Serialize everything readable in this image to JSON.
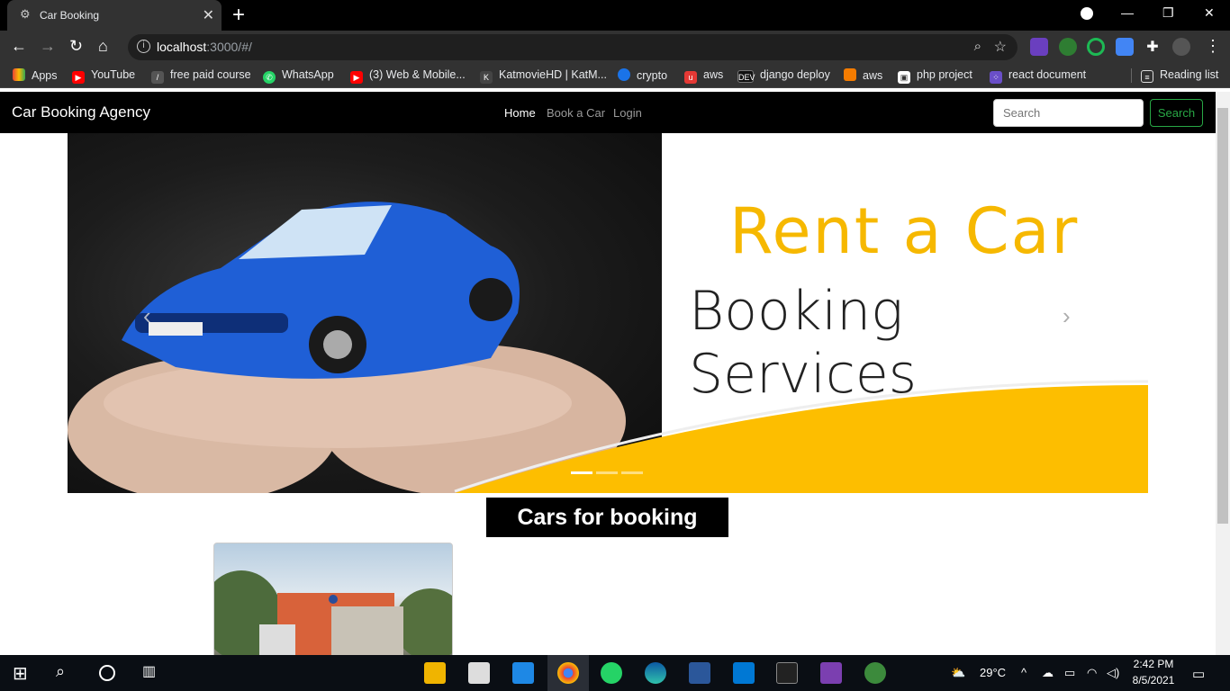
{
  "browser": {
    "tab_title": "Car Booking",
    "url_host": "localhost",
    "url_rest": ":3000/#/"
  },
  "bookmarks": [
    {
      "label": "Apps",
      "color": "#e94235"
    },
    {
      "label": "YouTube",
      "color": "#ff0000"
    },
    {
      "label": "free paid course",
      "color": "#555555"
    },
    {
      "label": "WhatsApp",
      "color": "#25d366"
    },
    {
      "label": "(3) Web & Mobile...",
      "color": "#ff0000"
    },
    {
      "label": "KatmovieHD | KatM...",
      "color": "#444444"
    },
    {
      "label": "crypto",
      "color": "#1a73e8"
    },
    {
      "label": "aws",
      "color": "#e53935"
    },
    {
      "label": "django deploy",
      "color": "#111111"
    },
    {
      "label": "aws",
      "color": "#f57c00"
    },
    {
      "label": "php project",
      "color": "#ffffff"
    },
    {
      "label": "react document",
      "color": "#6a4fc8"
    },
    {
      "label": "Reading list",
      "color": "#323232"
    }
  ],
  "navbar": {
    "brand": "Car Booking Agency",
    "links": [
      "Home",
      "Book a Car",
      "Login"
    ],
    "search_placeholder": "Search",
    "search_button": "Search"
  },
  "carousel": {
    "headline": "Rent a Car",
    "subheadline": "Booking Services",
    "accent_color": "#f6b800"
  },
  "section_heading": "Cars for booking",
  "taskbar": {
    "weather": "29°C",
    "time": "2:42 PM",
    "date": "8/5/2021"
  }
}
